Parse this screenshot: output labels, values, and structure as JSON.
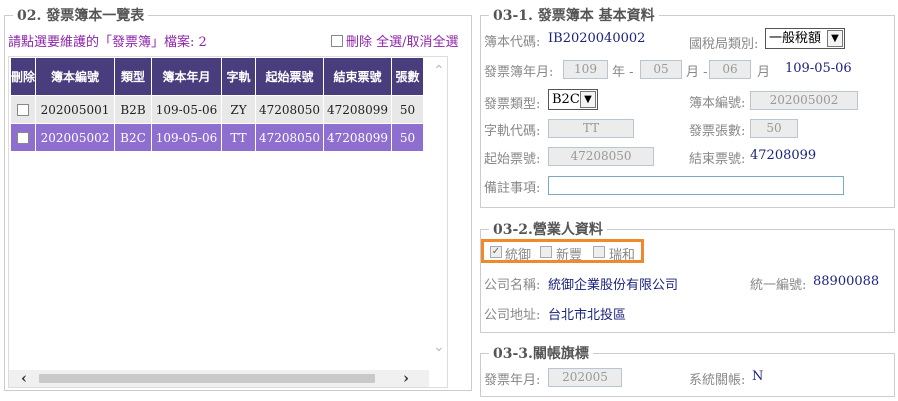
{
  "left": {
    "section_title": "02. 發票簿本一覽表",
    "count_text": "請點選要維護的「發票簿」檔案: 2",
    "select_all_label": "刪除 全選/取消全選",
    "columns": [
      "刪除",
      "簿本編號",
      "類型",
      "簿本年月",
      "字軌",
      "起始票號",
      "結束票號",
      "張數"
    ],
    "rows": [
      {
        "book_no": "202005001",
        "type": "B2B",
        "ym": "109-05-06",
        "track": "ZY",
        "start": "47208050",
        "end": "47208099",
        "count": "50"
      },
      {
        "book_no": "202005002",
        "type": "B2C",
        "ym": "109-05-06",
        "track": "TT",
        "start": "47208050",
        "end": "47208099",
        "count": "50"
      }
    ]
  },
  "basic": {
    "title": "03-1. 發票簿本 基本資料",
    "book_code_label": "簿本代碼:",
    "book_code": "IB2020040002",
    "tax_type_label": "國稅局類別:",
    "tax_type": "一般稅額",
    "ym_label": "發票簿年月:",
    "year": "109",
    "year_unit": "年 -",
    "month": "05",
    "month_unit": "月 -",
    "day": "06",
    "day_unit": "月",
    "date_display": "109-05-06",
    "invoice_type_label": "發票類型:",
    "invoice_type": "B2C",
    "book_no_label": "簿本編號:",
    "book_no": "202005002",
    "track_label": "字軌代碼:",
    "track": "TT",
    "sheet_count_label": "發票張數:",
    "sheet_count": "50",
    "start_label": "起始票號:",
    "start_no": "47208050",
    "end_label": "結束票號:",
    "end_no": "47208099",
    "note_label": "備註事項:",
    "note": ""
  },
  "business": {
    "title": "03-2.營業人資料",
    "companies": [
      {
        "name": "統御",
        "checked": true
      },
      {
        "name": "新豐",
        "checked": false
      },
      {
        "name": "瑞和",
        "checked": false
      }
    ],
    "company_name_label": "公司名稱:",
    "company_name": "統御企業股份有限公司",
    "tax_id_label": "統一編號:",
    "tax_id": "88900088",
    "address_label": "公司地址:",
    "address": "台北市北投區"
  },
  "closing": {
    "title": "03-3.關帳旗標",
    "ym_label": "發票年月:",
    "ym": "202005",
    "system_close_label": "系統關帳:",
    "system_close": "N"
  },
  "colors": {
    "header_bg": "#4a3d7d",
    "selected_row_bg": "#8e6fd0",
    "highlight_border": "#f0892b",
    "title_purple": "#8e24aa"
  }
}
